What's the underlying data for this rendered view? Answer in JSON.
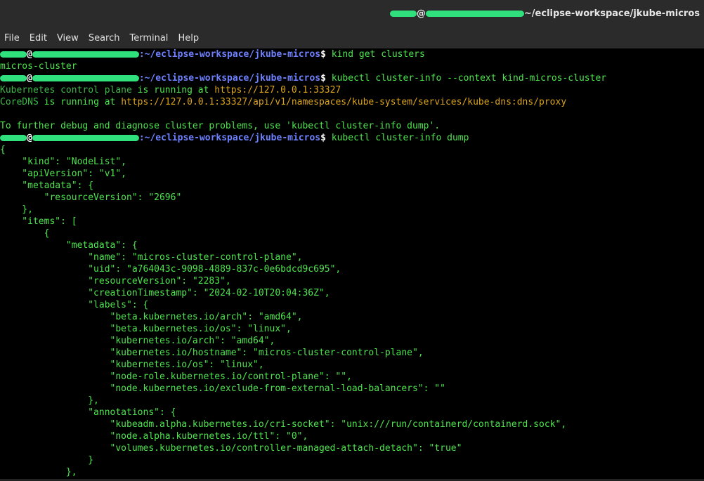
{
  "window": {
    "title_path": "~/eclipse-workspace/jkube-micros",
    "title_at": "@"
  },
  "menu": {
    "items": [
      "File",
      "Edit",
      "View",
      "Search",
      "Terminal",
      "Help"
    ]
  },
  "prompt": {
    "at": "@",
    "path": ":~/eclipse-workspace/jkube-micros",
    "symbol": "$"
  },
  "terminal": {
    "lines": [
      {
        "type": "prompt",
        "cmd": " kind get clusters"
      },
      {
        "type": "out",
        "text": "micros-cluster",
        "style": "green"
      },
      {
        "type": "prompt",
        "cmd": " kubectl cluster-info --context kind-micros-cluster"
      },
      {
        "type": "info1",
        "a": "Kubernetes control plane",
        "b": " is running at ",
        "c": "https://127.0.0.1:33327"
      },
      {
        "type": "info1",
        "a": "CoreDNS",
        "b": " is running at ",
        "c": "https://127.0.0.1:33327/api/v1/namespaces/kube-system/services/kube-dns:dns/proxy"
      },
      {
        "type": "out",
        "text": "",
        "style": "green"
      },
      {
        "type": "out",
        "text": "To further debug and diagnose cluster problems, use 'kubectl cluster-info dump'.",
        "style": "green"
      },
      {
        "type": "prompt",
        "cmd": " kubectl cluster-info dump"
      },
      {
        "type": "out",
        "text": "{",
        "style": "green"
      },
      {
        "type": "out",
        "text": "    \"kind\": \"NodeList\",",
        "style": "green"
      },
      {
        "type": "out",
        "text": "    \"apiVersion\": \"v1\",",
        "style": "green"
      },
      {
        "type": "out",
        "text": "    \"metadata\": {",
        "style": "green"
      },
      {
        "type": "out",
        "text": "        \"resourceVersion\": \"2696\"",
        "style": "green"
      },
      {
        "type": "out",
        "text": "    },",
        "style": "green"
      },
      {
        "type": "out",
        "text": "    \"items\": [",
        "style": "green"
      },
      {
        "type": "out",
        "text": "        {",
        "style": "green"
      },
      {
        "type": "out",
        "text": "            \"metadata\": {",
        "style": "green"
      },
      {
        "type": "out",
        "text": "                \"name\": \"micros-cluster-control-plane\",",
        "style": "green"
      },
      {
        "type": "out",
        "text": "                \"uid\": \"a764043c-9098-4889-837c-0e6bdcd9c695\",",
        "style": "green"
      },
      {
        "type": "out",
        "text": "                \"resourceVersion\": \"2283\",",
        "style": "green"
      },
      {
        "type": "out",
        "text": "                \"creationTimestamp\": \"2024-02-10T20:04:36Z\",",
        "style": "green"
      },
      {
        "type": "out",
        "text": "                \"labels\": {",
        "style": "green"
      },
      {
        "type": "out",
        "text": "                    \"beta.kubernetes.io/arch\": \"amd64\",",
        "style": "green"
      },
      {
        "type": "out",
        "text": "                    \"beta.kubernetes.io/os\": \"linux\",",
        "style": "green"
      },
      {
        "type": "out",
        "text": "                    \"kubernetes.io/arch\": \"amd64\",",
        "style": "green"
      },
      {
        "type": "out",
        "text": "                    \"kubernetes.io/hostname\": \"micros-cluster-control-plane\",",
        "style": "green"
      },
      {
        "type": "out",
        "text": "                    \"kubernetes.io/os\": \"linux\",",
        "style": "green"
      },
      {
        "type": "out",
        "text": "                    \"node-role.kubernetes.io/control-plane\": \"\",",
        "style": "green"
      },
      {
        "type": "out",
        "text": "                    \"node.kubernetes.io/exclude-from-external-load-balancers\": \"\"",
        "style": "green"
      },
      {
        "type": "out",
        "text": "                },",
        "style": "green"
      },
      {
        "type": "out",
        "text": "                \"annotations\": {",
        "style": "green"
      },
      {
        "type": "out",
        "text": "                    \"kubeadm.alpha.kubernetes.io/cri-socket\": \"unix:///run/containerd/containerd.sock\",",
        "style": "green"
      },
      {
        "type": "out",
        "text": "                    \"node.alpha.kubernetes.io/ttl\": \"0\",",
        "style": "green"
      },
      {
        "type": "out",
        "text": "                    \"volumes.kubernetes.io/controller-managed-attach-detach\": \"true\"",
        "style": "green"
      },
      {
        "type": "out",
        "text": "                }",
        "style": "green"
      },
      {
        "type": "out",
        "text": "            },",
        "style": "green"
      }
    ]
  }
}
